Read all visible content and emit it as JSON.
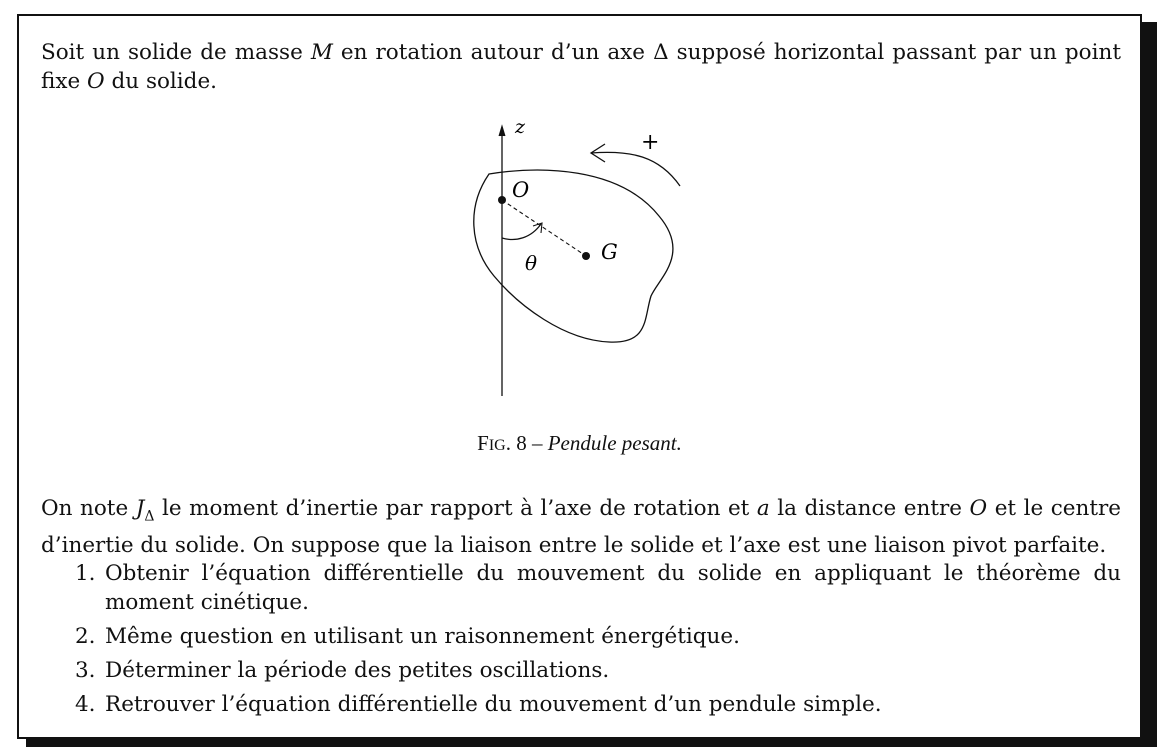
{
  "intro": {
    "t1": "Soit un solide de masse ",
    "m": "M",
    "t2": " en rotation autour d’un axe ",
    "delta": "Δ",
    "t3": " supposé horizontal passant par un point fixe ",
    "o": "O",
    "t4": " du solide."
  },
  "figure": {
    "label_z": "z",
    "label_o": "O",
    "label_g": "G",
    "label_theta": "θ",
    "label_plus": "+",
    "caption_prefix_big": "F",
    "caption_prefix_small": "ig",
    "caption_number": ". 8 – ",
    "caption_text": "Pendule pesant."
  },
  "body": {
    "t1": "On note ",
    "j": "J",
    "jsub": "Δ",
    "t2": " le moment d’inertie par rapport à l’axe de rotation et ",
    "a": "a",
    "t3": " la distance entre ",
    "o": "O",
    "t4": " et le centre d’inertie du solide. On suppose que la liaison entre le solide et l’axe est une liaison pivot parfaite."
  },
  "questions": [
    {
      "num": "1.",
      "text": "Obtenir l’équation différentielle du mouvement du solide en appliquant le théorème du moment cinétique."
    },
    {
      "num": "2.",
      "text": "Même question en utilisant un raisonnement énergétique."
    },
    {
      "num": "3.",
      "text": "Déterminer la période des petites oscillations."
    },
    {
      "num": "4.",
      "text": "Retrouver l’équation différentielle du mouvement d’un pendule simple."
    }
  ]
}
